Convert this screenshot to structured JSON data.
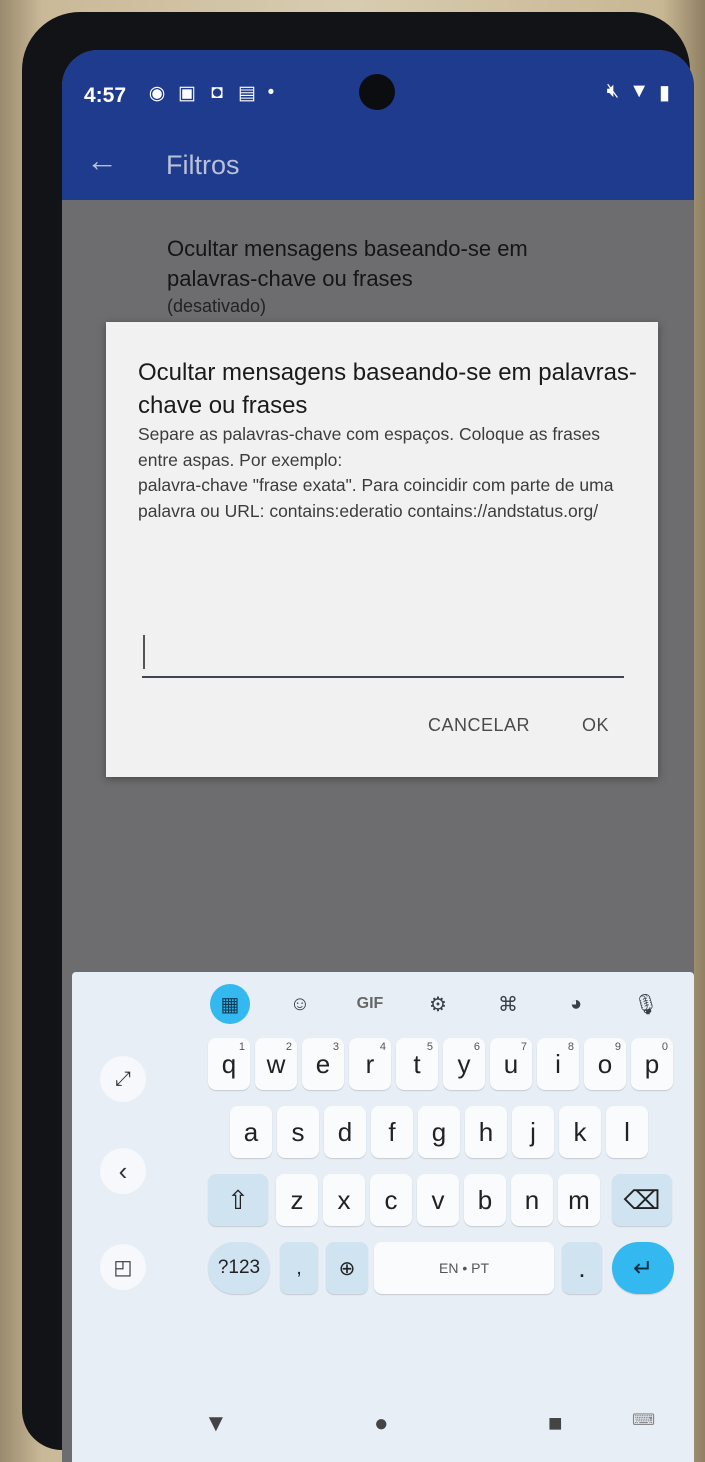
{
  "status_bar": {
    "time": "4:57",
    "left_icons": [
      "app-icon",
      "sim-icon",
      "bag-icon",
      "message-icon",
      "dot-icon"
    ],
    "right_icons": [
      "mute-icon",
      "wifi-icon",
      "battery-icon"
    ]
  },
  "app_bar": {
    "title": "Filtros"
  },
  "preference": {
    "title": "Ocultar mensagens baseando-se em palavras-chave ou frases",
    "summary": "(desativado)"
  },
  "dialog": {
    "title": "Ocultar mensagens baseando-se em palavras-chave ou frases",
    "message": "Separe as palavras-chave com espaços. Coloque as frases entre aspas. Por exemplo:\npalavra-chave \"frase exata\". Para coincidir com parte de uma palavra ou URL: contains:ederatio contains://andstatus.org/",
    "input_value": "",
    "cancel_label": "CANCELAR",
    "ok_label": "OK"
  },
  "keyboard": {
    "toolbar": [
      "apps-grid-icon",
      "sticker-icon",
      "GIF",
      "settings-icon",
      "translate-icon",
      "palette-icon",
      "mic-icon"
    ],
    "gif_label": "GIF",
    "row1": [
      {
        "k": "q",
        "n": "1"
      },
      {
        "k": "w",
        "n": "2"
      },
      {
        "k": "e",
        "n": "3"
      },
      {
        "k": "r",
        "n": "4"
      },
      {
        "k": "t",
        "n": "5"
      },
      {
        "k": "y",
        "n": "6"
      },
      {
        "k": "u",
        "n": "7"
      },
      {
        "k": "i",
        "n": "8"
      },
      {
        "k": "o",
        "n": "9"
      },
      {
        "k": "p",
        "n": "0"
      }
    ],
    "row2": [
      "a",
      "s",
      "d",
      "f",
      "g",
      "h",
      "j",
      "k",
      "l"
    ],
    "row3": [
      "z",
      "x",
      "c",
      "v",
      "b",
      "n",
      "m"
    ],
    "symbols_label": "?123",
    "emoji_comma": ",",
    "space_label": "EN • PT",
    "period_label": ".",
    "accent_color": "#33b8f0"
  },
  "nav_bar": [
    "back-triangle-icon",
    "home-circle-icon",
    "recents-square-icon",
    "keyboard-hide-icon"
  ]
}
